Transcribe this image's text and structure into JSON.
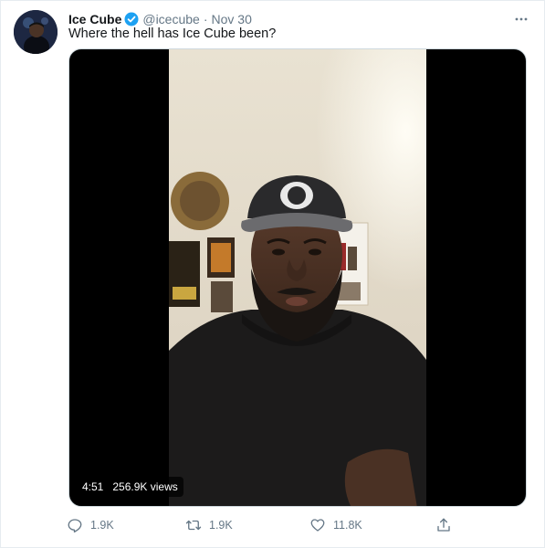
{
  "user": {
    "display_name": "Ice Cube",
    "handle": "@icecube",
    "separator": "·",
    "date": "Nov 30"
  },
  "tweet": {
    "text": "Where the hell has Ice Cube been?"
  },
  "video": {
    "duration": "4:51",
    "views": "256.9K views"
  },
  "actions": {
    "reply_count": "1.9K",
    "retweet_count": "1.9K",
    "like_count": "11.8K"
  },
  "icons": {
    "verified": "verified-badge-icon",
    "more": "more-options-icon",
    "reply": "reply-icon",
    "retweet": "retweet-icon",
    "like": "heart-icon",
    "share": "share-icon"
  },
  "colors": {
    "accent": "#1da1f2",
    "muted": "#657786",
    "text": "#14171a"
  }
}
